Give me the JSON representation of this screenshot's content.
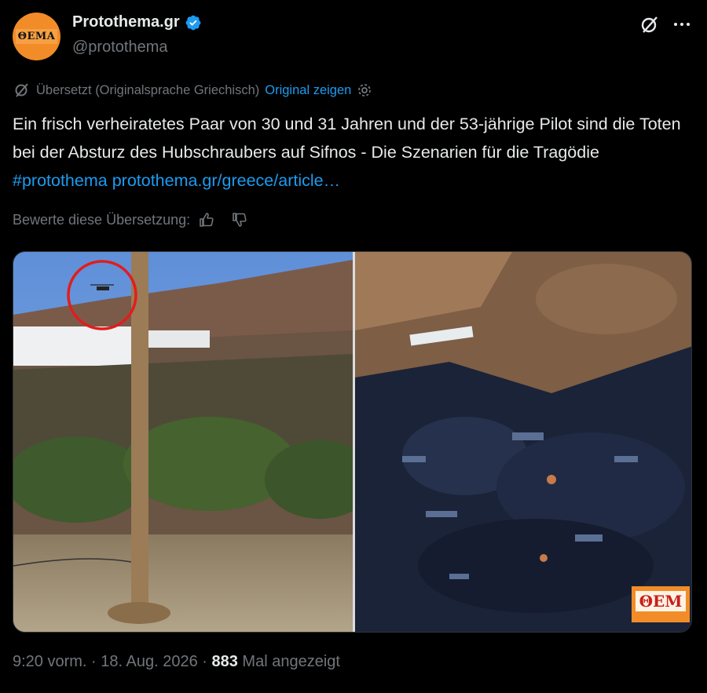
{
  "post": {
    "author": {
      "display_name": "Protothema.gr",
      "handle": "@protothema",
      "avatar_text": "ΘΕΜΑ",
      "verified": true
    },
    "icons": {
      "grok": "grok-icon",
      "more": "more-icon",
      "verified": "verified-badge-icon"
    },
    "translation": {
      "label": "Übersetzt (Originalsprache Griechisch)",
      "show_original": "Original zeigen"
    },
    "text": {
      "body": "Ein frisch verheiratetes Paar von 30 und 31 Jahren und der 53-jährige Pilot sind die Toten bei der Absturz des Hubschraubers auf Sifnos - Die Szenarien für die Tragödie ",
      "hashtag": "#protothema",
      "url": "protothema.gr/greece/article…"
    },
    "rate": {
      "label": "Bewerte diese Übersetzung:"
    },
    "media": {
      "watermark": "ΘΕΜ"
    },
    "meta": {
      "time": "9:20 vorm.",
      "sep1": " · ",
      "date": "18. Aug. 2026",
      "sep2": " · ",
      "views": "883",
      "views_label": " Mal angezeigt"
    }
  },
  "colors": {
    "background": "#000000",
    "text": "#e7e9ea",
    "muted": "#71767b",
    "link": "#1d9bf0",
    "avatar": "#f28c28"
  }
}
